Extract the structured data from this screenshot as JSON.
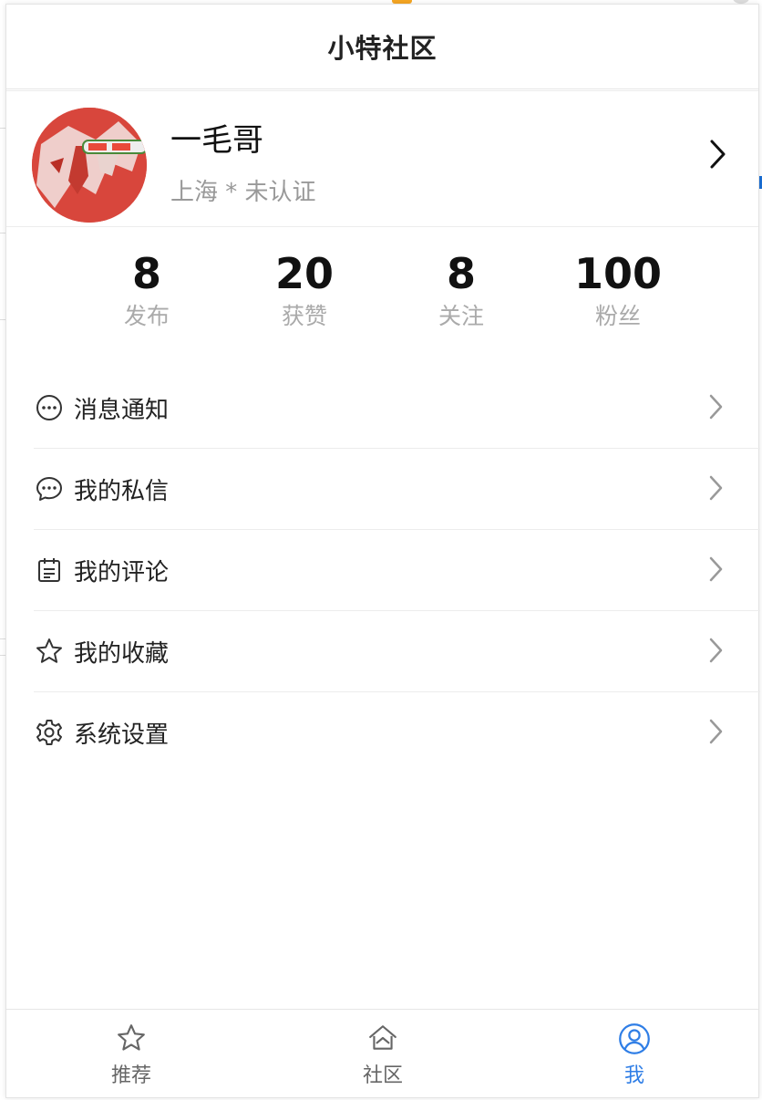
{
  "app": {
    "title": "小特社区"
  },
  "profile": {
    "name": "一毛哥",
    "subtitle": "上海 * 未认证"
  },
  "stats": [
    {
      "value": "8",
      "label": "发布"
    },
    {
      "value": "20",
      "label": "获赞"
    },
    {
      "value": "8",
      "label": "关注"
    },
    {
      "value": "100",
      "label": "粉丝"
    }
  ],
  "menu": [
    {
      "label": "消息通知",
      "icon": "message-dots-icon"
    },
    {
      "label": "我的私信",
      "icon": "chat-bubble-icon"
    },
    {
      "label": "我的评论",
      "icon": "comment-note-icon"
    },
    {
      "label": "我的收藏",
      "icon": "star-icon"
    },
    {
      "label": "系统设置",
      "icon": "gear-icon"
    }
  ],
  "tabbar": {
    "items": [
      {
        "label": "推荐",
        "icon": "star-icon"
      },
      {
        "label": "社区",
        "icon": "home-icon"
      },
      {
        "label": "我",
        "icon": "user-circle-icon"
      }
    ],
    "active_color": "#2f7ee6",
    "inactive_color": "#666666"
  },
  "colors": {
    "accent": "#2f7ee6",
    "avatar": "#d8463c"
  }
}
